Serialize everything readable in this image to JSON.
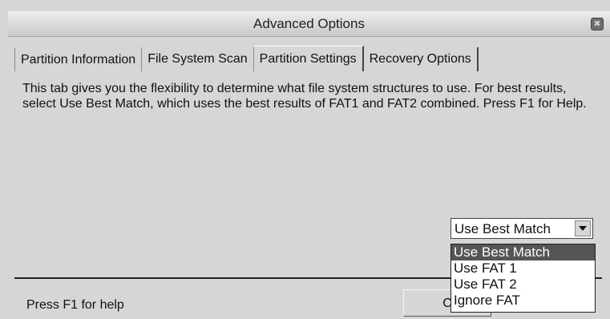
{
  "window": {
    "title": "Advanced Options",
    "close_glyph": "✖"
  },
  "tabs": [
    {
      "label": "Partition Information"
    },
    {
      "label": "File System Scan"
    },
    {
      "label": "Partition Settings",
      "active": true
    },
    {
      "label": "Recovery Options"
    }
  ],
  "panel": {
    "description": "This tab gives you the flexibility to determine what file system structures to use. For best results, select Use Best Match, which uses the best results of FAT1 and FAT2 combined. Press F1 for Help."
  },
  "combo": {
    "selected_value": "Use Best Match",
    "options": [
      "Use Best Match",
      "Use FAT 1",
      "Use FAT 2",
      "Ignore FAT"
    ],
    "highlighted_index": 0
  },
  "footer": {
    "status_text": "Press F1 for help",
    "button_label": "C"
  },
  "colors": {
    "dialog_bg": "#d6d6d6",
    "selection_bg": "#555555",
    "selection_fg": "#ffffff"
  }
}
